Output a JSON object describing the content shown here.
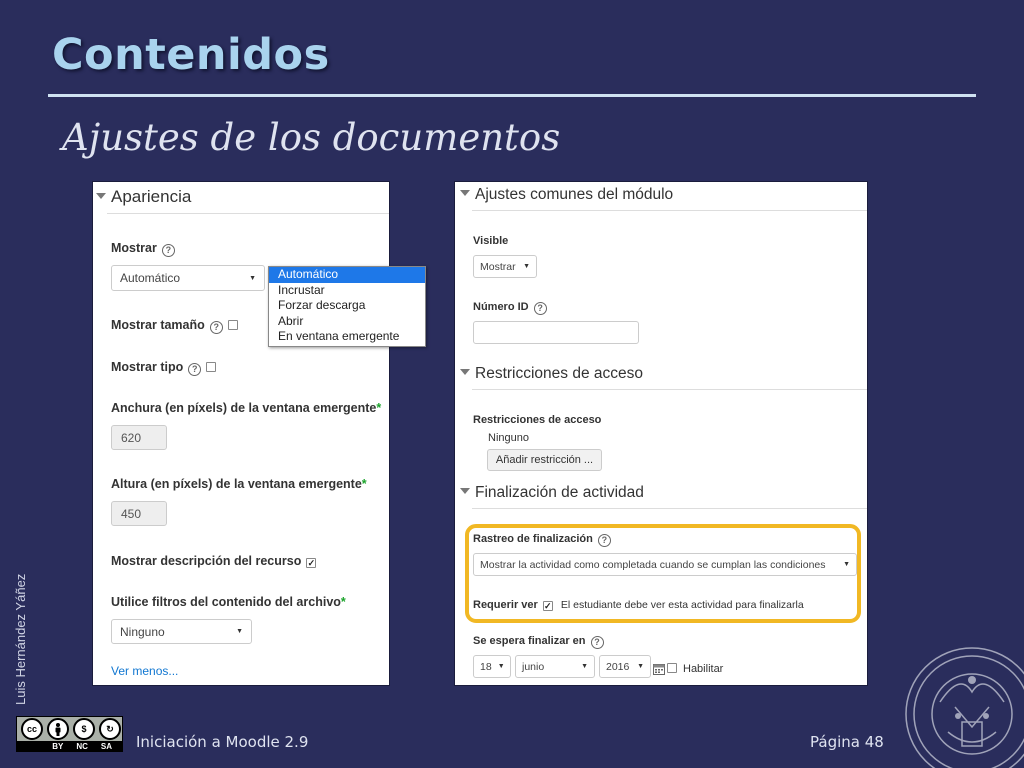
{
  "slide": {
    "title": "Contenidos",
    "subtitle": "Ajustes de los documentos",
    "author": "Luis Hernández Yáñez",
    "footer_course": "Iniciación a Moodle 2.9",
    "footer_page": "Página 48",
    "license": {
      "cc": "cc",
      "by": "BY",
      "nc": "NC",
      "sa": "SA"
    }
  },
  "left_panel": {
    "section_title": "Apariencia",
    "mostrar": {
      "label": "Mostrar",
      "value": "Automático",
      "options": [
        "Automático",
        "Incrustar",
        "Forzar descarga",
        "Abrir",
        "En ventana emergente"
      ]
    },
    "mostrar_tamano": {
      "label": "Mostrar tamaño",
      "checked": false
    },
    "mostrar_tipo": {
      "label": "Mostrar tipo",
      "checked": false
    },
    "anchura": {
      "label": "Anchura (en píxels) de la ventana emergente",
      "required_mark": "*",
      "value": "620"
    },
    "altura": {
      "label": "Altura (en píxels) de la ventana emergente",
      "required_mark": "*",
      "value": "450"
    },
    "mostrar_descripcion": {
      "label": "Mostrar descripción del recurso",
      "checked": true
    },
    "filtros": {
      "label": "Utilice filtros del contenido del archivo",
      "required_mark": "*",
      "value": "Ninguno"
    },
    "ver_menos": "Ver menos..."
  },
  "right_panel": {
    "ajustes_comunes": {
      "section_title": "Ajustes comunes del módulo",
      "visible_label": "Visible",
      "visible_value": "Mostrar",
      "numero_id_label": "Número ID",
      "numero_id_value": ""
    },
    "restricciones": {
      "section_title": "Restricciones de acceso",
      "label": "Restricciones de acceso",
      "value": "Ninguno",
      "add_button": "Añadir restricción ..."
    },
    "finalizacion": {
      "section_title": "Finalización de actividad",
      "rastreo_label": "Rastreo de finalización",
      "rastreo_value": "Mostrar la actividad como completada cuando se cumplan las condiciones",
      "requerir_ver_label": "Requerir ver",
      "requerir_ver_checked": true,
      "requerir_ver_text": "El estudiante debe ver esta actividad para finalizarla",
      "espera_label": "Se espera finalizar en",
      "day": "18",
      "month": "junio",
      "year": "2016",
      "habilitar_label": "Habilitar",
      "habilitar_checked": false
    }
  },
  "colors": {
    "background": "#2a2d5c",
    "title": "#a9d3ee",
    "highlight": "#f1b824",
    "selected_option": "#1e78e8",
    "link": "#1177d1",
    "required": "#1aa32a"
  }
}
